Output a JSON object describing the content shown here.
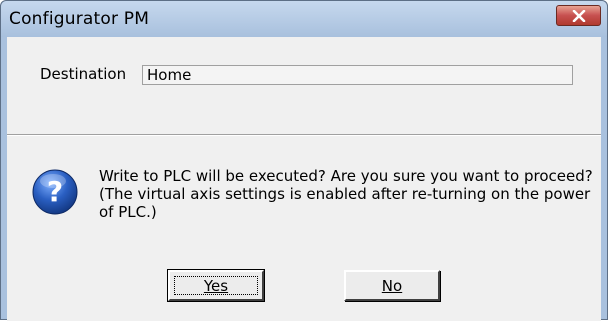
{
  "window": {
    "title": "Configurator PM",
    "close_icon": "close-icon"
  },
  "destination": {
    "label": "Destination",
    "value": "Home"
  },
  "message": {
    "icon": "question-icon",
    "line1": "Write to PLC will be executed? Are you sure you want to proceed?",
    "line2": "(The virtual axis settings is enabled after re-turning on the power of PLC.)"
  },
  "buttons": {
    "yes_label": "Yes",
    "no_label": "No"
  },
  "colors": {
    "titlebar": "#b4cbe6",
    "client": "#f0f0f0",
    "close_button": "#c75050",
    "icon_blue": "#1f4fa3"
  }
}
